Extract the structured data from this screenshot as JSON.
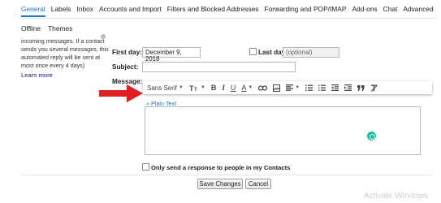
{
  "tabs": {
    "row1": [
      "General",
      "Labels",
      "Inbox",
      "Accounts and Import",
      "Filters and Blocked Addresses",
      "Forwarding and POP/IMAP",
      "Add-ons",
      "Chat",
      "Advanced"
    ],
    "row2": [
      "Offline",
      "Themes"
    ]
  },
  "side_note": {
    "lines": [
      "incoming messages. If a contact",
      "sends you several messages, this",
      "automated reply will be sent at",
      "most once every 4 days)"
    ],
    "learn_more": "Learn more"
  },
  "vacation": {
    "first_day_label": "First day:",
    "first_day_value": "December 9, 2018",
    "last_day_label": "Last day:",
    "last_day_placeholder": "(optional)",
    "subject_label": "Subject:",
    "subject_value": "",
    "message_label": "Message:",
    "plain_text_link": "« Plain Text",
    "only_contacts_label": "Only send a response to people in my Contacts"
  },
  "toolbar": {
    "font_name": "Sans Serif",
    "bold": "B",
    "italic": "I",
    "underline": "U",
    "text_color": "A",
    "icons": [
      "undo-icon",
      "redo-icon",
      "font-size-icon",
      "text-color-icon",
      "link-icon",
      "image-icon",
      "align-icon",
      "numbered-list-icon",
      "bulleted-list-icon",
      "indent-less-icon",
      "indent-more-icon",
      "quote-icon",
      "remove-formatting-icon"
    ]
  },
  "buttons": {
    "save": "Save Changes",
    "cancel": "Cancel"
  },
  "watermark": "Activate Windows",
  "colors": {
    "accent": "#1a73e8",
    "arrow": "#e02020",
    "grammarly": "#15c39a"
  }
}
